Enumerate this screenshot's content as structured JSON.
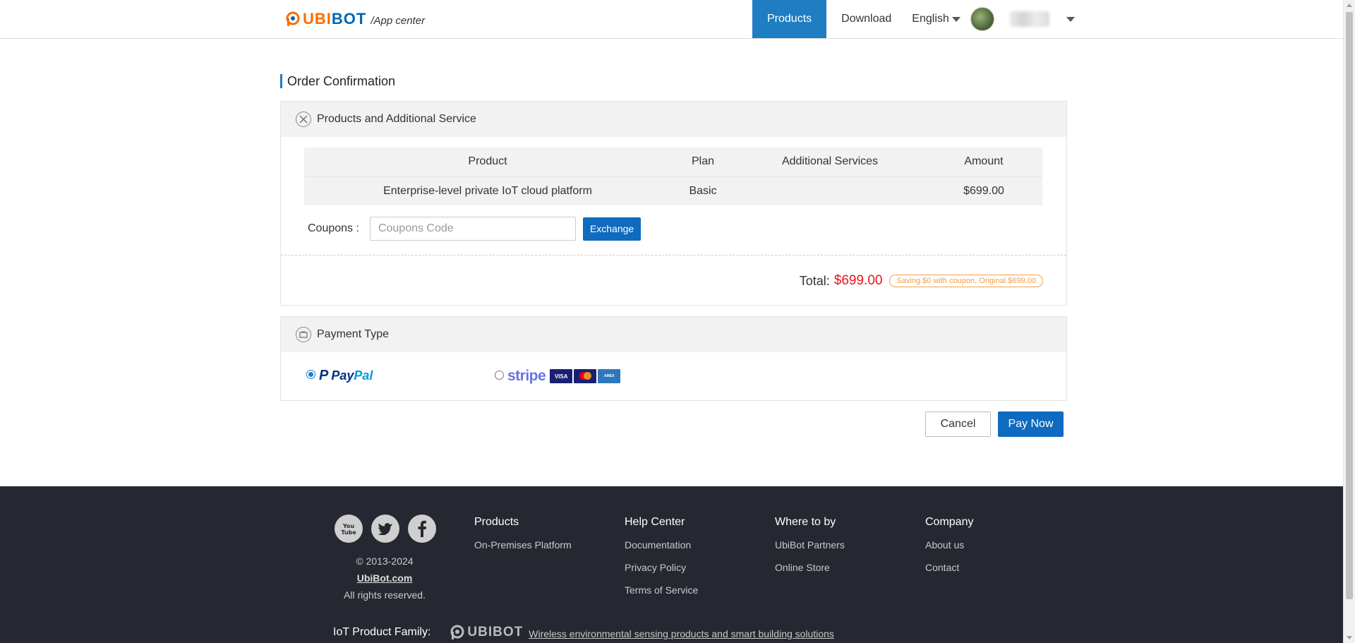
{
  "header": {
    "logo_text_ubi": "UBI",
    "logo_text_bot": "BOT",
    "logo_subtitle": "/App center",
    "nav": [
      "Products",
      "Download"
    ],
    "language": "English"
  },
  "page": {
    "title": "Order Confirmation"
  },
  "products_panel": {
    "title": "Products and Additional Service",
    "columns": [
      "Product",
      "Plan",
      "Additional Services",
      "Amount"
    ],
    "rows": [
      [
        "Enterprise-level private IoT cloud platform",
        "Basic",
        "",
        "$699.00"
      ]
    ],
    "coupon_label": "Coupons :",
    "coupon_placeholder": "Coupons Code",
    "coupon_value": "",
    "exchange_label": "Exchange",
    "total_label": "Total:",
    "total_value": "$699.00",
    "saving_text": "Saving $0 with coupon, Original $699.00"
  },
  "payment_panel": {
    "title": "Payment Type",
    "options": [
      {
        "name": "PayPal",
        "selected": true
      },
      {
        "name": "stripe",
        "selected": false,
        "cards": [
          "VISA",
          "MasterCard",
          "AMERICAN EXPRESS"
        ]
      }
    ],
    "paypal_pay": "Pay",
    "paypal_pal": "Pal",
    "stripe_label": "stripe"
  },
  "actions": {
    "cancel_label": "Cancel",
    "pay_label": "Pay Now"
  },
  "footer": {
    "social": [
      "youtube-icon",
      "twitter-icon",
      "facebook-icon"
    ],
    "copyright": "© 2013-2024",
    "site": "UbiBot.com",
    "rights": "All rights reserved.",
    "columns": [
      {
        "title": "Products",
        "links": [
          "On-Premises Platform"
        ]
      },
      {
        "title": "Help Center",
        "links": [
          "Documentation",
          "Privacy Policy",
          "Terms of Service"
        ]
      },
      {
        "title": "Where to by",
        "links": [
          "UbiBot Partners",
          "Online Store"
        ]
      },
      {
        "title": "Company",
        "links": [
          "About us",
          "Contact"
        ]
      }
    ],
    "family_label": "IoT Product Family:",
    "family_logo": "UBIBOT",
    "family_link": "Wireless environmental sensing products and smart building solutions"
  },
  "colors": {
    "brand_blue": "#1f7dc1",
    "button_blue": "#0e6bbf",
    "total_red": "#e8131b",
    "saving_orange": "#f0a04b",
    "footer_bg": "#252830"
  }
}
